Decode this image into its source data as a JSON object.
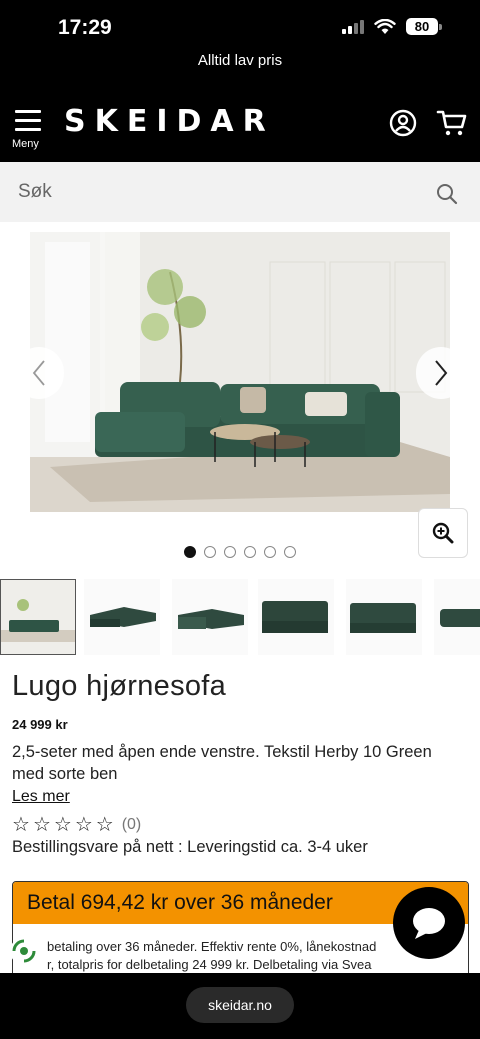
{
  "status_bar": {
    "time": "17:29",
    "battery": "80"
  },
  "promo": {
    "text": "Alltid lav pris"
  },
  "header": {
    "menu_label": "Meny",
    "logo": "SKEIDAR"
  },
  "search": {
    "placeholder": "Søk"
  },
  "gallery": {
    "image_count": 6,
    "active_index": 0
  },
  "product": {
    "title": "Lugo hjørnesofa",
    "price": "24 999 kr",
    "description": "2,5-seter med åpen ende venstre. Tekstil Herby 10 Green med sorte ben",
    "read_more": "Les mer",
    "rating_count": "(0)",
    "availability": "Bestillingsvare på nett : Leveringstid ca. 3-4 uker"
  },
  "finance": {
    "headline": "Betal 694,42 kr over 36 måneder",
    "line1": "betaling over 36 måneder. Effektiv rente 0%, lånekostnad",
    "line2": "r, totalpris for delbetaling 24 999 kr. Delbetaling via Svea"
  },
  "browser": {
    "url": "skeidar.no"
  },
  "colors": {
    "accent": "#f39200",
    "header_bg": "#000000",
    "search_bg": "#f2f2f2"
  }
}
